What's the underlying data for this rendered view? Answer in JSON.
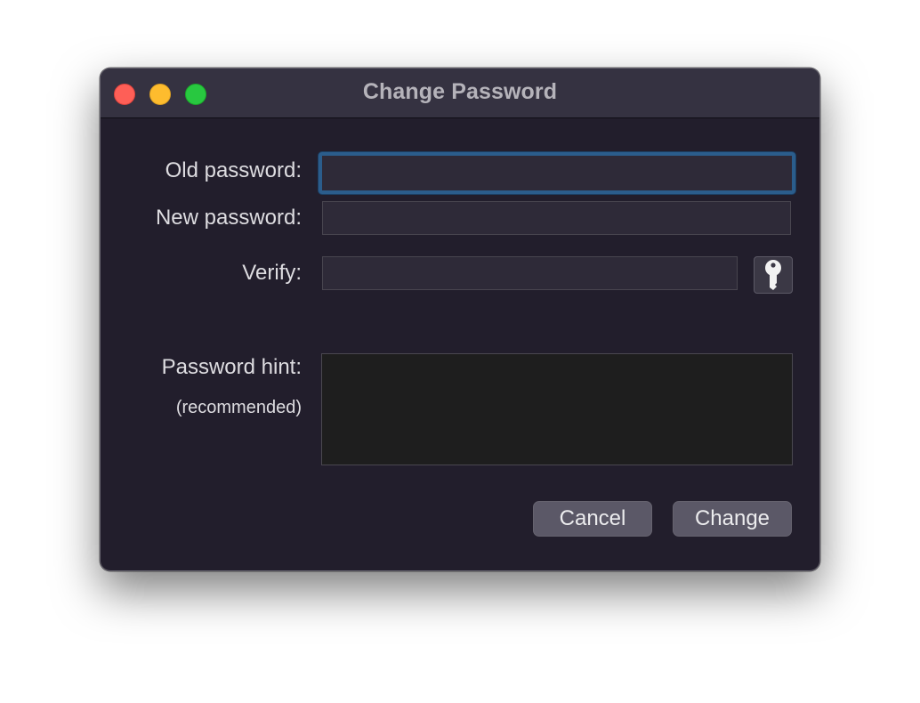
{
  "window": {
    "title": "Change Password"
  },
  "traffic_lights": {
    "close": "#fe5f57",
    "minimize": "#febc2e",
    "zoom": "#28c840"
  },
  "form": {
    "old_password": {
      "label": "Old password:",
      "value": ""
    },
    "new_password": {
      "label": "New password:",
      "value": ""
    },
    "verify": {
      "label": "Verify:",
      "value": ""
    },
    "password_assistant": {
      "icon": "key-icon"
    },
    "hint": {
      "label": "Password hint:",
      "sublabel": "(recommended)",
      "value": ""
    }
  },
  "buttons": {
    "cancel": "Cancel",
    "change": "Change"
  },
  "colors": {
    "window_bg": "#221e2c",
    "titlebar_bg": "#353241",
    "focus_ring": "#2b5d8c",
    "button_bg": "#5b5867"
  }
}
